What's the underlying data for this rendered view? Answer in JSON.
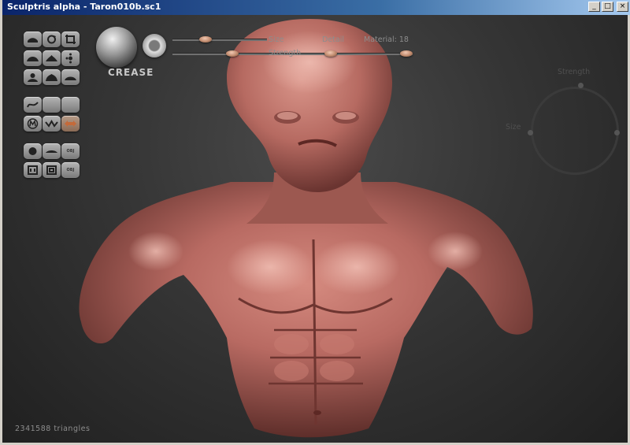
{
  "window": {
    "title": "Sculptris alpha - Taron010b.sc1",
    "buttons": {
      "minimize": "_",
      "maximize": "□",
      "close": "×"
    }
  },
  "brush": {
    "name": "CREASE"
  },
  "sliders": {
    "size_label": "Size",
    "detail_label": "Detail",
    "strength_label": "Strength",
    "material_label": "Material: 18",
    "size_value": 0.35,
    "detail_value": 0.6,
    "strength_value": 0.35
  },
  "dial": {
    "strength_label": "Strength",
    "size_label": "Size"
  },
  "status": {
    "triangles": "2341588 triangles"
  },
  "toolbar": {
    "group1": [
      "draw-icon",
      "rotate-icon",
      "crop-icon",
      "inflate-icon",
      "pinch-icon",
      "grab-icon",
      "flatten-icon",
      "smooth-icon",
      "layer-icon"
    ],
    "group2": [
      "curve-icon",
      "blank-icon",
      "blank-icon",
      "symmetry-icon",
      "wave-icon",
      "wireframe-toggle-icon"
    ],
    "group3": [
      "sphere-icon",
      "plane-icon",
      "export-obj-icon",
      "open-icon",
      "save-icon",
      "import-obj-icon"
    ],
    "obj_label": "OBJ"
  },
  "colors": {
    "skin": "#b86a62",
    "knob": "#d6a084",
    "background": "#333333"
  }
}
